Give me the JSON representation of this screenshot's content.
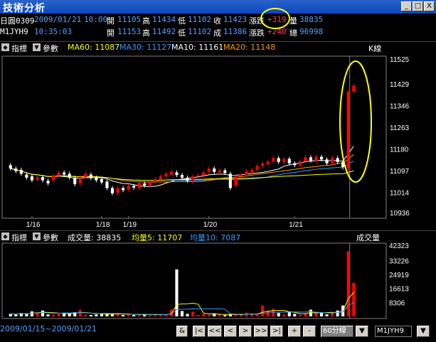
{
  "window": {
    "title": "技術分析",
    "min": "_",
    "max": "□",
    "close": "X"
  },
  "quote1": {
    "name": "日圓0309",
    "date": "2009/01/21",
    "time": "10:00",
    "open_l": "開",
    "open": "11105",
    "high_l": "高",
    "high": "11434",
    "low_l": "低",
    "low": "11102",
    "close_l": "收",
    "close": "11423",
    "chg_l": "漲跌",
    "chg": "+319",
    "vol_l": "量",
    "vol": "38835"
  },
  "quote2": {
    "name": "M1JYH9",
    "time": "10:35:03",
    "open_l": "開",
    "open": "11153",
    "high_l": "高",
    "high": "11492",
    "low_l": "低",
    "low": "11102",
    "close_l": "成",
    "close": "11386",
    "chg_l": "漲跌",
    "chg": "+240",
    "vol_l": "總",
    "vol": "96998"
  },
  "price_panel": {
    "ind_l": "指標",
    "param_l": "參數",
    "ma60": "MA60: 11087",
    "ma30": "MA30: 11127",
    "ma10": "MA10: 11161",
    "ma20": "MA20: 11148",
    "label": "K線",
    "yticks": [
      "11525",
      "11429",
      "11346",
      "11263",
      "11180",
      "11097",
      "11014",
      "10936"
    ],
    "xticks": [
      "1/16",
      "1/18",
      "1/19",
      "1/20",
      "1/21"
    ]
  },
  "vol_panel": {
    "ind_l": "指標",
    "param_l": "參數",
    "vol": "成交量: 38835",
    "ma5": "均量5: 11707",
    "ma10": "均量10: 7087",
    "label": "成交量",
    "yticks": [
      "42323",
      "33226",
      "24919",
      "16613",
      "8306"
    ]
  },
  "bottom": {
    "range": "2009/01/15~2009/01/21",
    "and": "&",
    "first": "|<",
    "prev2": "<<",
    "prev": "<",
    "next": ">",
    "next2": ">>",
    "last": ">|",
    "plus": "+",
    "minus": "-",
    "period": "60分線",
    "symbol": "M1JYH9"
  },
  "colors": {
    "up": "#ff0000",
    "down": "#ffffff",
    "ma60": "#ffff00",
    "ma30": "#3399ff",
    "ma10": "#ffffff",
    "ma20": "#ff9900",
    "highlight": "#ffff00"
  },
  "chart_data": {
    "type": "candlestick",
    "candles": [
      {
        "o": 11118,
        "c": 11105
      },
      {
        "o": 11105,
        "c": 11095
      },
      {
        "o": 11100,
        "c": 11085
      },
      {
        "o": 11082,
        "c": 11070
      },
      {
        "o": 11075,
        "c": 11060
      },
      {
        "o": 11062,
        "c": 11072
      },
      {
        "o": 11072,
        "c": 11060
      },
      {
        "o": 11058,
        "c": 11048
      },
      {
        "o": 11060,
        "c": 11078
      },
      {
        "o": 11078,
        "c": 11090
      },
      {
        "o": 11090,
        "c": 11082
      },
      {
        "o": 11085,
        "c": 11070
      },
      {
        "o": 11070,
        "c": 11045
      },
      {
        "o": 11048,
        "c": 11072
      },
      {
        "o": 11072,
        "c": 11085
      },
      {
        "o": 11082,
        "c": 11068
      },
      {
        "o": 11070,
        "c": 11060
      },
      {
        "o": 11065,
        "c": 11052
      },
      {
        "o": 11055,
        "c": 11030
      },
      {
        "o": 11030,
        "c": 11010
      },
      {
        "o": 11012,
        "c": 11030
      },
      {
        "o": 11030,
        "c": 11022
      },
      {
        "o": 11025,
        "c": 11038
      },
      {
        "o": 11038,
        "c": 11032
      },
      {
        "o": 11030,
        "c": 11050
      },
      {
        "o": 11048,
        "c": 11040
      },
      {
        "o": 11040,
        "c": 11055
      },
      {
        "o": 11055,
        "c": 11065
      },
      {
        "o": 11062,
        "c": 11075
      },
      {
        "o": 11075,
        "c": 11085
      },
      {
        "o": 11082,
        "c": 11092
      },
      {
        "o": 11090,
        "c": 11080
      },
      {
        "o": 11080,
        "c": 11070
      },
      {
        "o": 11070,
        "c": 11058
      },
      {
        "o": 11058,
        "c": 11075
      },
      {
        "o": 11075,
        "c": 11078
      },
      {
        "o": 11078,
        "c": 11090
      },
      {
        "o": 11092,
        "c": 11105
      },
      {
        "o": 11105,
        "c": 11092
      },
      {
        "o": 11090,
        "c": 11098
      },
      {
        "o": 11098,
        "c": 11088
      },
      {
        "o": 11085,
        "c": 11030
      },
      {
        "o": 11040,
        "c": 11075
      },
      {
        "o": 11075,
        "c": 11082
      },
      {
        "o": 11082,
        "c": 11095
      },
      {
        "o": 11090,
        "c": 11100
      },
      {
        "o": 11100,
        "c": 11115
      },
      {
        "o": 11115,
        "c": 11125
      },
      {
        "o": 11122,
        "c": 11132
      },
      {
        "o": 11132,
        "c": 11145
      },
      {
        "o": 11145,
        "c": 11130
      },
      {
        "o": 11130,
        "c": 11142
      },
      {
        "o": 11142,
        "c": 11125
      },
      {
        "o": 11125,
        "c": 11118
      },
      {
        "o": 11118,
        "c": 11132
      },
      {
        "o": 11132,
        "c": 11148
      },
      {
        "o": 11148,
        "c": 11135
      },
      {
        "o": 11135,
        "c": 11150
      },
      {
        "o": 11150,
        "c": 11140
      },
      {
        "o": 11140,
        "c": 11125
      },
      {
        "o": 11125,
        "c": 11145
      },
      {
        "o": 11145,
        "c": 11130
      },
      {
        "o": 11130,
        "c": 11110
      },
      {
        "o": 11105,
        "c": 11400
      },
      {
        "o": 11400,
        "c": 11423
      }
    ],
    "volumes": [
      1500,
      1200,
      2000,
      1800,
      3000,
      2500,
      3500,
      1200,
      1000,
      1500,
      2200,
      1800,
      2500,
      3800,
      1000,
      800,
      1200,
      1500,
      1800,
      1600,
      1200,
      800,
      1500,
      900,
      1100,
      1400,
      900,
      1000,
      1200,
      900,
      4000,
      28000,
      3200,
      1500,
      2800,
      900,
      1400,
      1000,
      1800,
      1200,
      800,
      1100,
      1400,
      900,
      2200,
      1500,
      1200,
      6500,
      3500,
      4500,
      2000,
      1200,
      2800,
      1500,
      1000,
      1800,
      4000,
      2400,
      2000,
      1200,
      2500,
      3500,
      6500,
      38835,
      20000
    ]
  }
}
